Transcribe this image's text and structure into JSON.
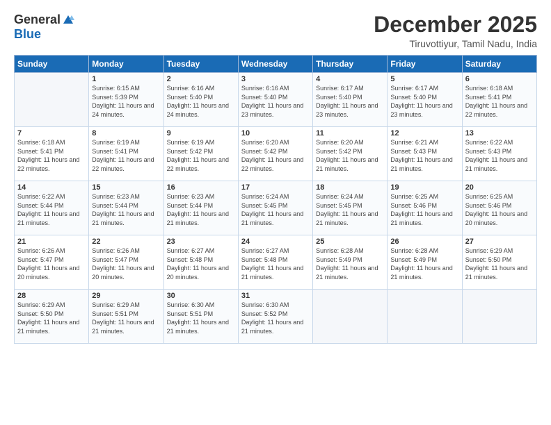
{
  "logo": {
    "general": "General",
    "blue": "Blue"
  },
  "header": {
    "month": "December 2025",
    "location": "Tiruvottiyur, Tamil Nadu, India"
  },
  "weekdays": [
    "Sunday",
    "Monday",
    "Tuesday",
    "Wednesday",
    "Thursday",
    "Friday",
    "Saturday"
  ],
  "weeks": [
    [
      {
        "day": "",
        "sunrise": "",
        "sunset": "",
        "daylight": ""
      },
      {
        "day": "1",
        "sunrise": "Sunrise: 6:15 AM",
        "sunset": "Sunset: 5:39 PM",
        "daylight": "Daylight: 11 hours and 24 minutes."
      },
      {
        "day": "2",
        "sunrise": "Sunrise: 6:16 AM",
        "sunset": "Sunset: 5:40 PM",
        "daylight": "Daylight: 11 hours and 24 minutes."
      },
      {
        "day": "3",
        "sunrise": "Sunrise: 6:16 AM",
        "sunset": "Sunset: 5:40 PM",
        "daylight": "Daylight: 11 hours and 23 minutes."
      },
      {
        "day": "4",
        "sunrise": "Sunrise: 6:17 AM",
        "sunset": "Sunset: 5:40 PM",
        "daylight": "Daylight: 11 hours and 23 minutes."
      },
      {
        "day": "5",
        "sunrise": "Sunrise: 6:17 AM",
        "sunset": "Sunset: 5:40 PM",
        "daylight": "Daylight: 11 hours and 23 minutes."
      },
      {
        "day": "6",
        "sunrise": "Sunrise: 6:18 AM",
        "sunset": "Sunset: 5:41 PM",
        "daylight": "Daylight: 11 hours and 22 minutes."
      }
    ],
    [
      {
        "day": "7",
        "sunrise": "Sunrise: 6:18 AM",
        "sunset": "Sunset: 5:41 PM",
        "daylight": "Daylight: 11 hours and 22 minutes."
      },
      {
        "day": "8",
        "sunrise": "Sunrise: 6:19 AM",
        "sunset": "Sunset: 5:41 PM",
        "daylight": "Daylight: 11 hours and 22 minutes."
      },
      {
        "day": "9",
        "sunrise": "Sunrise: 6:19 AM",
        "sunset": "Sunset: 5:42 PM",
        "daylight": "Daylight: 11 hours and 22 minutes."
      },
      {
        "day": "10",
        "sunrise": "Sunrise: 6:20 AM",
        "sunset": "Sunset: 5:42 PM",
        "daylight": "Daylight: 11 hours and 22 minutes."
      },
      {
        "day": "11",
        "sunrise": "Sunrise: 6:20 AM",
        "sunset": "Sunset: 5:42 PM",
        "daylight": "Daylight: 11 hours and 21 minutes."
      },
      {
        "day": "12",
        "sunrise": "Sunrise: 6:21 AM",
        "sunset": "Sunset: 5:43 PM",
        "daylight": "Daylight: 11 hours and 21 minutes."
      },
      {
        "day": "13",
        "sunrise": "Sunrise: 6:22 AM",
        "sunset": "Sunset: 5:43 PM",
        "daylight": "Daylight: 11 hours and 21 minutes."
      }
    ],
    [
      {
        "day": "14",
        "sunrise": "Sunrise: 6:22 AM",
        "sunset": "Sunset: 5:44 PM",
        "daylight": "Daylight: 11 hours and 21 minutes."
      },
      {
        "day": "15",
        "sunrise": "Sunrise: 6:23 AM",
        "sunset": "Sunset: 5:44 PM",
        "daylight": "Daylight: 11 hours and 21 minutes."
      },
      {
        "day": "16",
        "sunrise": "Sunrise: 6:23 AM",
        "sunset": "Sunset: 5:44 PM",
        "daylight": "Daylight: 11 hours and 21 minutes."
      },
      {
        "day": "17",
        "sunrise": "Sunrise: 6:24 AM",
        "sunset": "Sunset: 5:45 PM",
        "daylight": "Daylight: 11 hours and 21 minutes."
      },
      {
        "day": "18",
        "sunrise": "Sunrise: 6:24 AM",
        "sunset": "Sunset: 5:45 PM",
        "daylight": "Daylight: 11 hours and 21 minutes."
      },
      {
        "day": "19",
        "sunrise": "Sunrise: 6:25 AM",
        "sunset": "Sunset: 5:46 PM",
        "daylight": "Daylight: 11 hours and 21 minutes."
      },
      {
        "day": "20",
        "sunrise": "Sunrise: 6:25 AM",
        "sunset": "Sunset: 5:46 PM",
        "daylight": "Daylight: 11 hours and 20 minutes."
      }
    ],
    [
      {
        "day": "21",
        "sunrise": "Sunrise: 6:26 AM",
        "sunset": "Sunset: 5:47 PM",
        "daylight": "Daylight: 11 hours and 20 minutes."
      },
      {
        "day": "22",
        "sunrise": "Sunrise: 6:26 AM",
        "sunset": "Sunset: 5:47 PM",
        "daylight": "Daylight: 11 hours and 20 minutes."
      },
      {
        "day": "23",
        "sunrise": "Sunrise: 6:27 AM",
        "sunset": "Sunset: 5:48 PM",
        "daylight": "Daylight: 11 hours and 20 minutes."
      },
      {
        "day": "24",
        "sunrise": "Sunrise: 6:27 AM",
        "sunset": "Sunset: 5:48 PM",
        "daylight": "Daylight: 11 hours and 21 minutes."
      },
      {
        "day": "25",
        "sunrise": "Sunrise: 6:28 AM",
        "sunset": "Sunset: 5:49 PM",
        "daylight": "Daylight: 11 hours and 21 minutes."
      },
      {
        "day": "26",
        "sunrise": "Sunrise: 6:28 AM",
        "sunset": "Sunset: 5:49 PM",
        "daylight": "Daylight: 11 hours and 21 minutes."
      },
      {
        "day": "27",
        "sunrise": "Sunrise: 6:29 AM",
        "sunset": "Sunset: 5:50 PM",
        "daylight": "Daylight: 11 hours and 21 minutes."
      }
    ],
    [
      {
        "day": "28",
        "sunrise": "Sunrise: 6:29 AM",
        "sunset": "Sunset: 5:50 PM",
        "daylight": "Daylight: 11 hours and 21 minutes."
      },
      {
        "day": "29",
        "sunrise": "Sunrise: 6:29 AM",
        "sunset": "Sunset: 5:51 PM",
        "daylight": "Daylight: 11 hours and 21 minutes."
      },
      {
        "day": "30",
        "sunrise": "Sunrise: 6:30 AM",
        "sunset": "Sunset: 5:51 PM",
        "daylight": "Daylight: 11 hours and 21 minutes."
      },
      {
        "day": "31",
        "sunrise": "Sunrise: 6:30 AM",
        "sunset": "Sunset: 5:52 PM",
        "daylight": "Daylight: 11 hours and 21 minutes."
      },
      {
        "day": "",
        "sunrise": "",
        "sunset": "",
        "daylight": ""
      },
      {
        "day": "",
        "sunrise": "",
        "sunset": "",
        "daylight": ""
      },
      {
        "day": "",
        "sunrise": "",
        "sunset": "",
        "daylight": ""
      }
    ]
  ]
}
